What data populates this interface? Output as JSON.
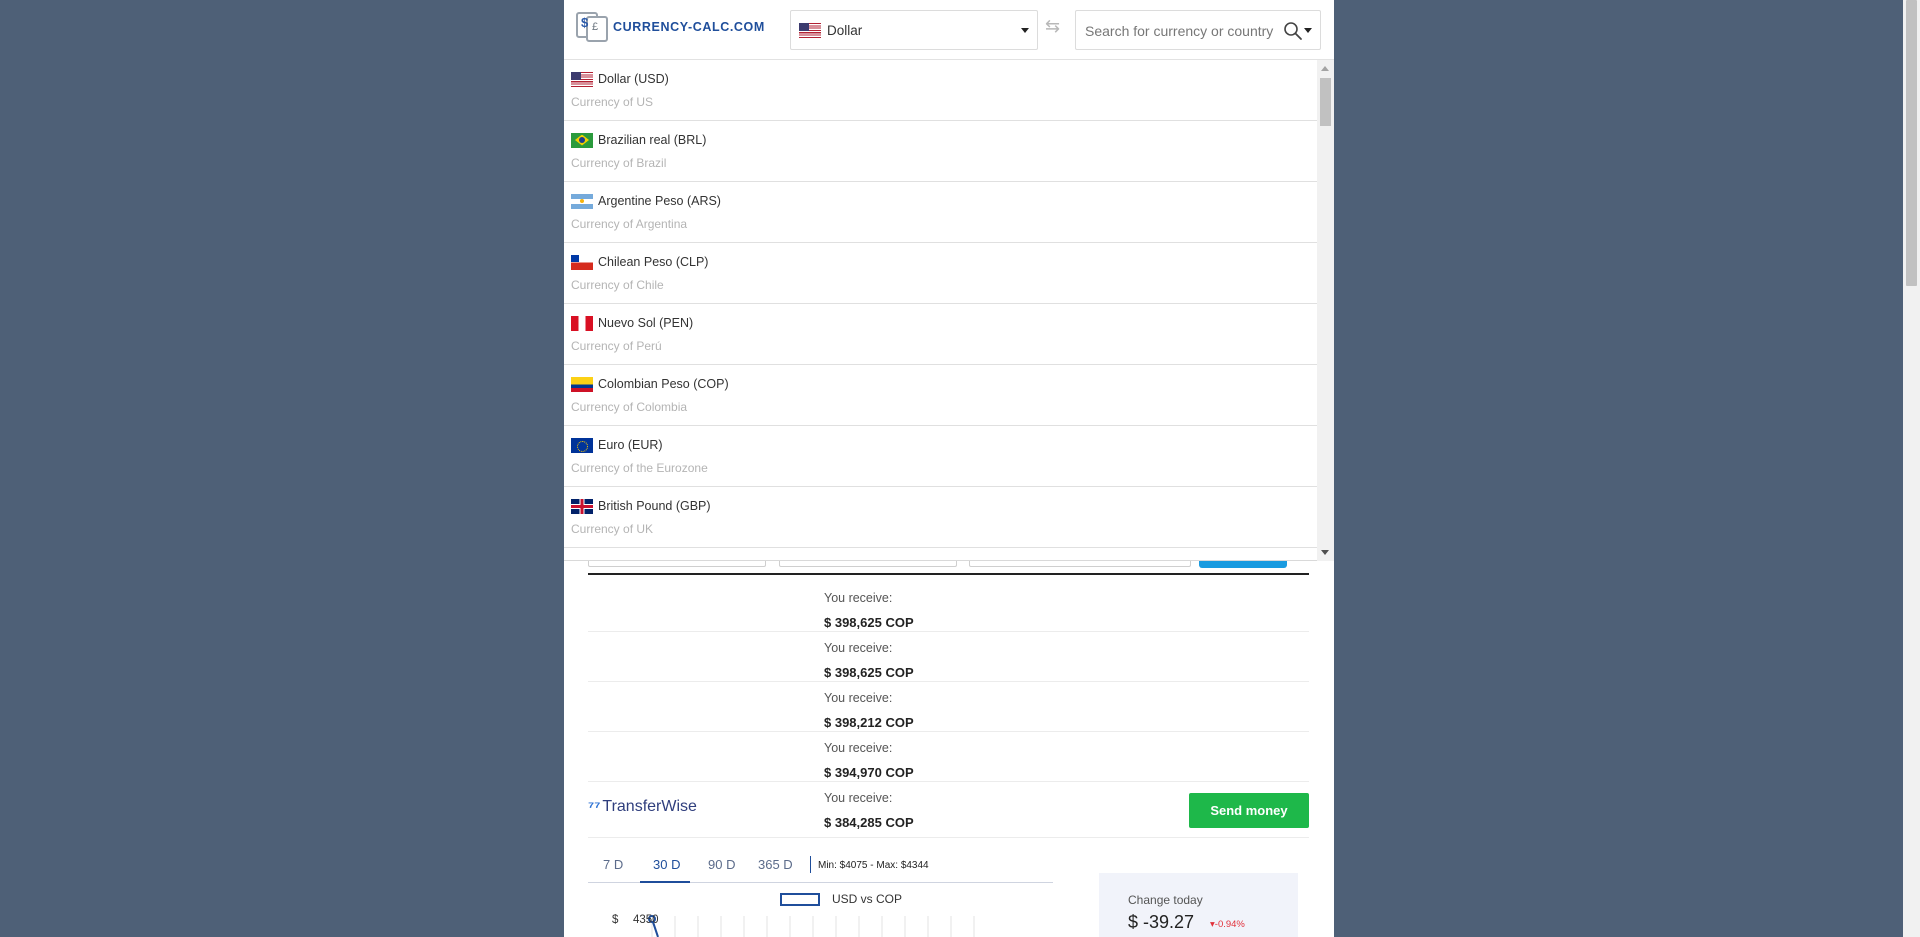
{
  "header": {
    "logo_text": "CURRENCY-CALC.COM",
    "selected_currency": "Dollar",
    "selected_flag": "us",
    "swap_icon": "swap-arrows-icon",
    "search_placeholder": "Search for currency or country"
  },
  "dropdown": {
    "items": [
      {
        "flag": "us",
        "name": "Dollar (USD)",
        "sub": "Currency of US"
      },
      {
        "flag": "br",
        "name": "Brazilian real (BRL)",
        "sub": "Currency of Brazil"
      },
      {
        "flag": "ar",
        "name": "Argentine Peso (ARS)",
        "sub": "Currency of Argentina"
      },
      {
        "flag": "cl",
        "name": "Chilean Peso (CLP)",
        "sub": "Currency of Chile"
      },
      {
        "flag": "pe",
        "name": "Nuevo Sol (PEN)",
        "sub": "Currency of Perú"
      },
      {
        "flag": "co",
        "name": "Colombian Peso (COP)",
        "sub": "Currency of Colombia"
      },
      {
        "flag": "eu",
        "name": "Euro (EUR)",
        "sub": "Currency of the Eurozone"
      },
      {
        "flag": "gb",
        "name": "British Pound (GBP)",
        "sub": "Currency of UK"
      }
    ]
  },
  "results": {
    "rows": [
      {
        "label": "You receive:",
        "amount": "$ 398,625 COP"
      },
      {
        "label": "You receive:",
        "amount": "$ 398,625 COP"
      },
      {
        "label": "You receive:",
        "amount": "$ 398,212 COP"
      },
      {
        "label": "You receive:",
        "amount": "$ 394,970 COP"
      },
      {
        "label": "You receive:",
        "amount": "$ 384,285 COP"
      }
    ],
    "provider_name": "TransferWise",
    "provider_symbol": "⁷⁷",
    "send_button": "Send money"
  },
  "chart_tabs": {
    "tabs": [
      "7 D",
      "30 D",
      "90 D",
      "365 D"
    ],
    "active_index": 1,
    "minmax": "Min: $4075 - Max: $4344"
  },
  "chart_data": {
    "type": "line",
    "series": [
      {
        "name": "USD vs COP",
        "values": [
          4344
        ]
      }
    ],
    "y_tick_currency": "$",
    "y_tick_label": "4350",
    "accent_color": "#1f4e9b"
  },
  "change_today": {
    "label": "Change today",
    "value": "$ -39.27",
    "percent": "-0.94%",
    "color_negative": "#e2303a"
  }
}
